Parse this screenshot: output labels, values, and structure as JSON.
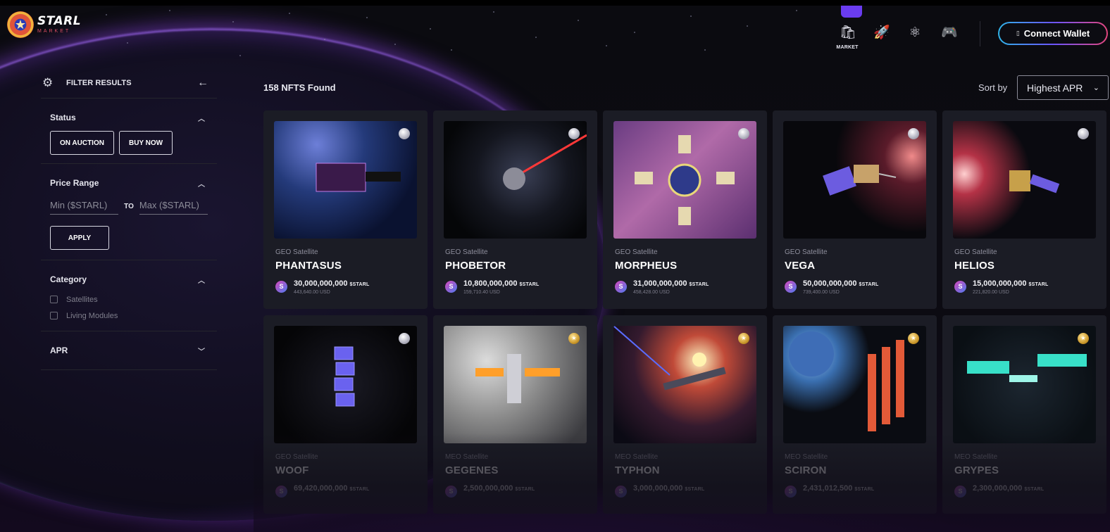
{
  "header": {
    "logo_name": "STARL",
    "logo_sub": "MARKET",
    "nav": [
      {
        "icon": "shopping-bag-icon",
        "glyph": "🛍",
        "label": "MARKET",
        "active": true
      },
      {
        "icon": "rocket-icon",
        "glyph": "🚀",
        "label": ""
      },
      {
        "icon": "atom-icon",
        "glyph": "⚛",
        "label": ""
      },
      {
        "icon": "gamepad-icon",
        "glyph": "🎮",
        "label": ""
      }
    ],
    "connect_label": "Connect Wallet",
    "accent": "#6a3cf0"
  },
  "sidebar": {
    "title": "FILTER RESULTS",
    "status": {
      "title": "Status",
      "buttons": [
        "ON AUCTION",
        "BUY NOW"
      ]
    },
    "price_range": {
      "title": "Price Range",
      "min_placeholder": "Min ($STARL)",
      "to_label": "TO",
      "max_placeholder": "Max ($STARL)",
      "apply_label": "APPLY"
    },
    "category": {
      "title": "Category",
      "options": [
        "Satellites",
        "Living Modules"
      ]
    },
    "apr": {
      "title": "APR"
    }
  },
  "results": {
    "count": "158",
    "count_suffix": "NFTS Found",
    "sort_label": "Sort by",
    "sort_value": "Highest APR"
  },
  "cards": [
    {
      "type": "GEO Satellite",
      "name": "PHANTASUS",
      "price": "30,000,000,000",
      "unit": "$STARL",
      "usd": "443,640.00 USD",
      "tier": "silver"
    },
    {
      "type": "GEO Satellite",
      "name": "PHOBETOR",
      "price": "10,800,000,000",
      "unit": "$STARL",
      "usd": "159,710.40 USD",
      "tier": "silver"
    },
    {
      "type": "GEO Satellite",
      "name": "MORPHEUS",
      "price": "31,000,000,000",
      "unit": "$STARL",
      "usd": "458,428.00 USD",
      "tier": "silver"
    },
    {
      "type": "GEO Satellite",
      "name": "VEGA",
      "price": "50,000,000,000",
      "unit": "$STARL",
      "usd": "739,400.00 USD",
      "tier": "silver"
    },
    {
      "type": "GEO Satellite",
      "name": "HELIOS",
      "price": "15,000,000,000",
      "unit": "$STARL",
      "usd": "221,820.00 USD",
      "tier": "silver"
    },
    {
      "type": "GEO Satellite",
      "name": "WOOF",
      "price": "69,420,000,000",
      "unit": "$STARL",
      "usd": "",
      "tier": "silver"
    },
    {
      "type": "MEO Satellite",
      "name": "GEGENES",
      "price": "2,500,000,000",
      "unit": "$STARL",
      "usd": "",
      "tier": "gold"
    },
    {
      "type": "MEO Satellite",
      "name": "TYPHON",
      "price": "3,000,000,000",
      "unit": "$STARL",
      "usd": "",
      "tier": "gold"
    },
    {
      "type": "MEO Satellite",
      "name": "SCIRON",
      "price": "2,431,012,500",
      "unit": "$STARL",
      "usd": "",
      "tier": "gold"
    },
    {
      "type": "MEO Satellite",
      "name": "GRYPES",
      "price": "2,300,000,000",
      "unit": "$STARL",
      "usd": "",
      "tier": "gold"
    }
  ]
}
